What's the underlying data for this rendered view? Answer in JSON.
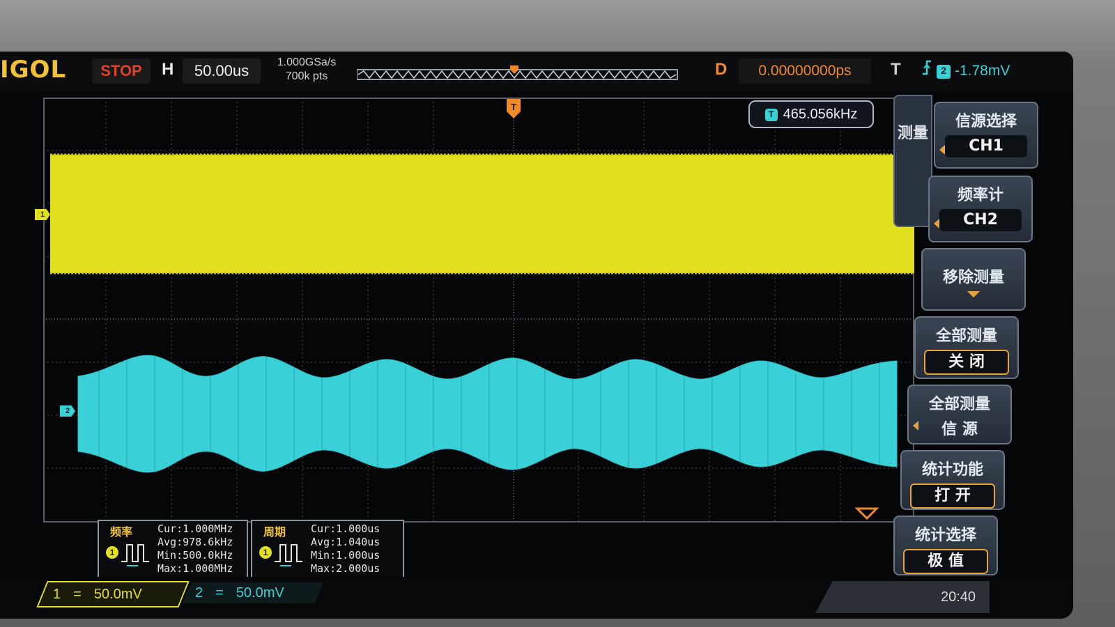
{
  "status_bar": {
    "brand": "IGOL",
    "run_state": "STOP",
    "horizontal_label": "H",
    "timebase": "50.00us",
    "sample_rate": "1.000GSa/s",
    "memory_depth": "700k pts",
    "delay_label": "D",
    "delay_value": "0.00000000ps",
    "trigger_label": "T",
    "trigger_source": "2",
    "trigger_level": "-1.78mV"
  },
  "counter_readout": {
    "source_badge": "T",
    "value": "465.056kHz"
  },
  "markers": {
    "ch1": "1",
    "ch2": "2"
  },
  "measurements": [
    {
      "title": "频率",
      "badge": "1",
      "cur": "Cur:1.000MHz",
      "avg": "Avg:978.6kHz",
      "min": "Min:500.0kHz",
      "max": "Max:1.000MHz"
    },
    {
      "title": "周期",
      "badge": "1",
      "cur": "Cur:1.000us",
      "avg": "Avg:1.040us",
      "min": "Min:1.000us",
      "max": "Max:2.000us"
    }
  ],
  "bottom_bar": {
    "ch1_num": "1",
    "ch1_coupling": "=",
    "ch1_scale": "50.0mV",
    "ch2_num": "2",
    "ch2_coupling": "=",
    "ch2_scale": "50.0mV",
    "clock": "20:40"
  },
  "menu": {
    "tab_label": "测量",
    "items": [
      {
        "title": "信源选择",
        "value": "CH1"
      },
      {
        "title": "频率计",
        "value": "CH2"
      },
      {
        "title": "移除测量",
        "value": ""
      },
      {
        "title": "全部测量",
        "value": "关 闭"
      },
      {
        "title": "全部测量",
        "value": "信 源"
      },
      {
        "title": "统计功能",
        "value": "打 开"
      },
      {
        "title": "统计选择",
        "value": "极 值"
      }
    ]
  },
  "colors": {
    "ch1": "#e3e020",
    "ch2": "#3ad0d8",
    "accent": "#ef8a2a"
  }
}
